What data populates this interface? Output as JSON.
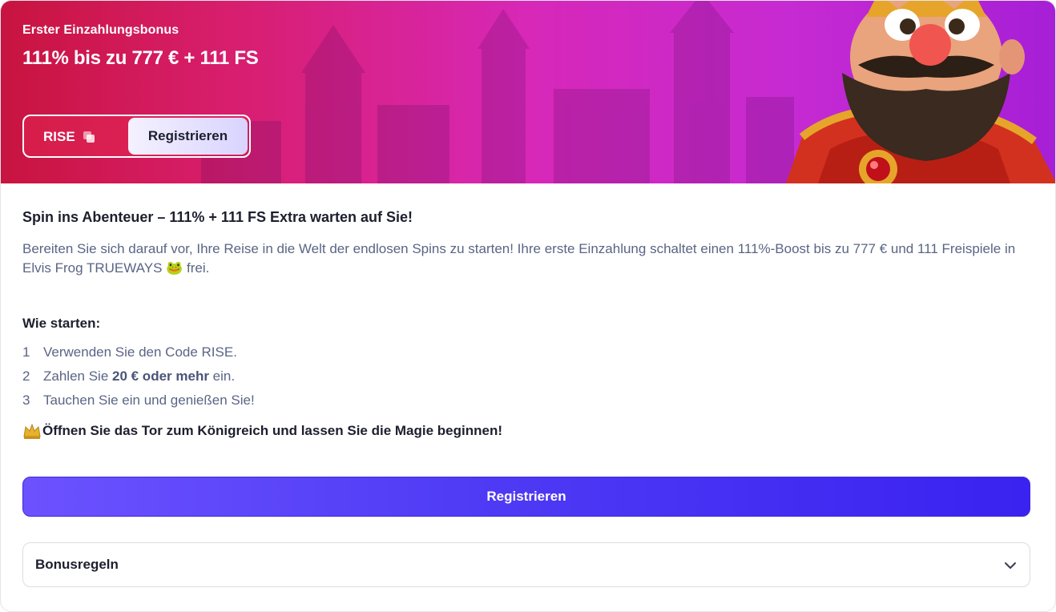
{
  "banner": {
    "subtitle": "Erster Einzahlungsbonus",
    "title": "111% bis zu 777 € + 111 FS",
    "code": "RISE",
    "copy_icon": "copy-icon",
    "register_label": "Registrieren"
  },
  "content": {
    "headline": "Spin ins Abenteuer – 111% + 111 FS Extra warten auf Sie!",
    "description": "Bereiten Sie sich darauf vor, Ihre Reise in die Welt der endlosen Spins zu starten! Ihre erste Einzahlung schaltet einen 111%-Boost bis zu 777 € und 111 Freispiele in Elvis Frog TRUEWAYS 🐸 frei.",
    "how_title": "Wie starten:",
    "steps": [
      {
        "num": "1",
        "text": "Verwenden Sie den Code RISE."
      },
      {
        "num": "2",
        "pre": "Zahlen Sie ",
        "bold": "20 € oder mehr",
        "post": " ein."
      },
      {
        "num": "3",
        "text": "Tauchen Sie ein und genießen Sie!"
      }
    ],
    "cta_icon": "crown-icon",
    "cta": "Öffnen Sie das Tor zum Königreich und lassen Sie die Magie beginnen!"
  },
  "register_button": "Registrieren",
  "rules": {
    "label": "Bonusregeln",
    "icon": "chevron-down-icon"
  },
  "colors": {
    "primary": "#4f3bf5",
    "banner_start": "#c8143f",
    "banner_end": "#a61fd6",
    "text_muted": "#5a6585"
  }
}
